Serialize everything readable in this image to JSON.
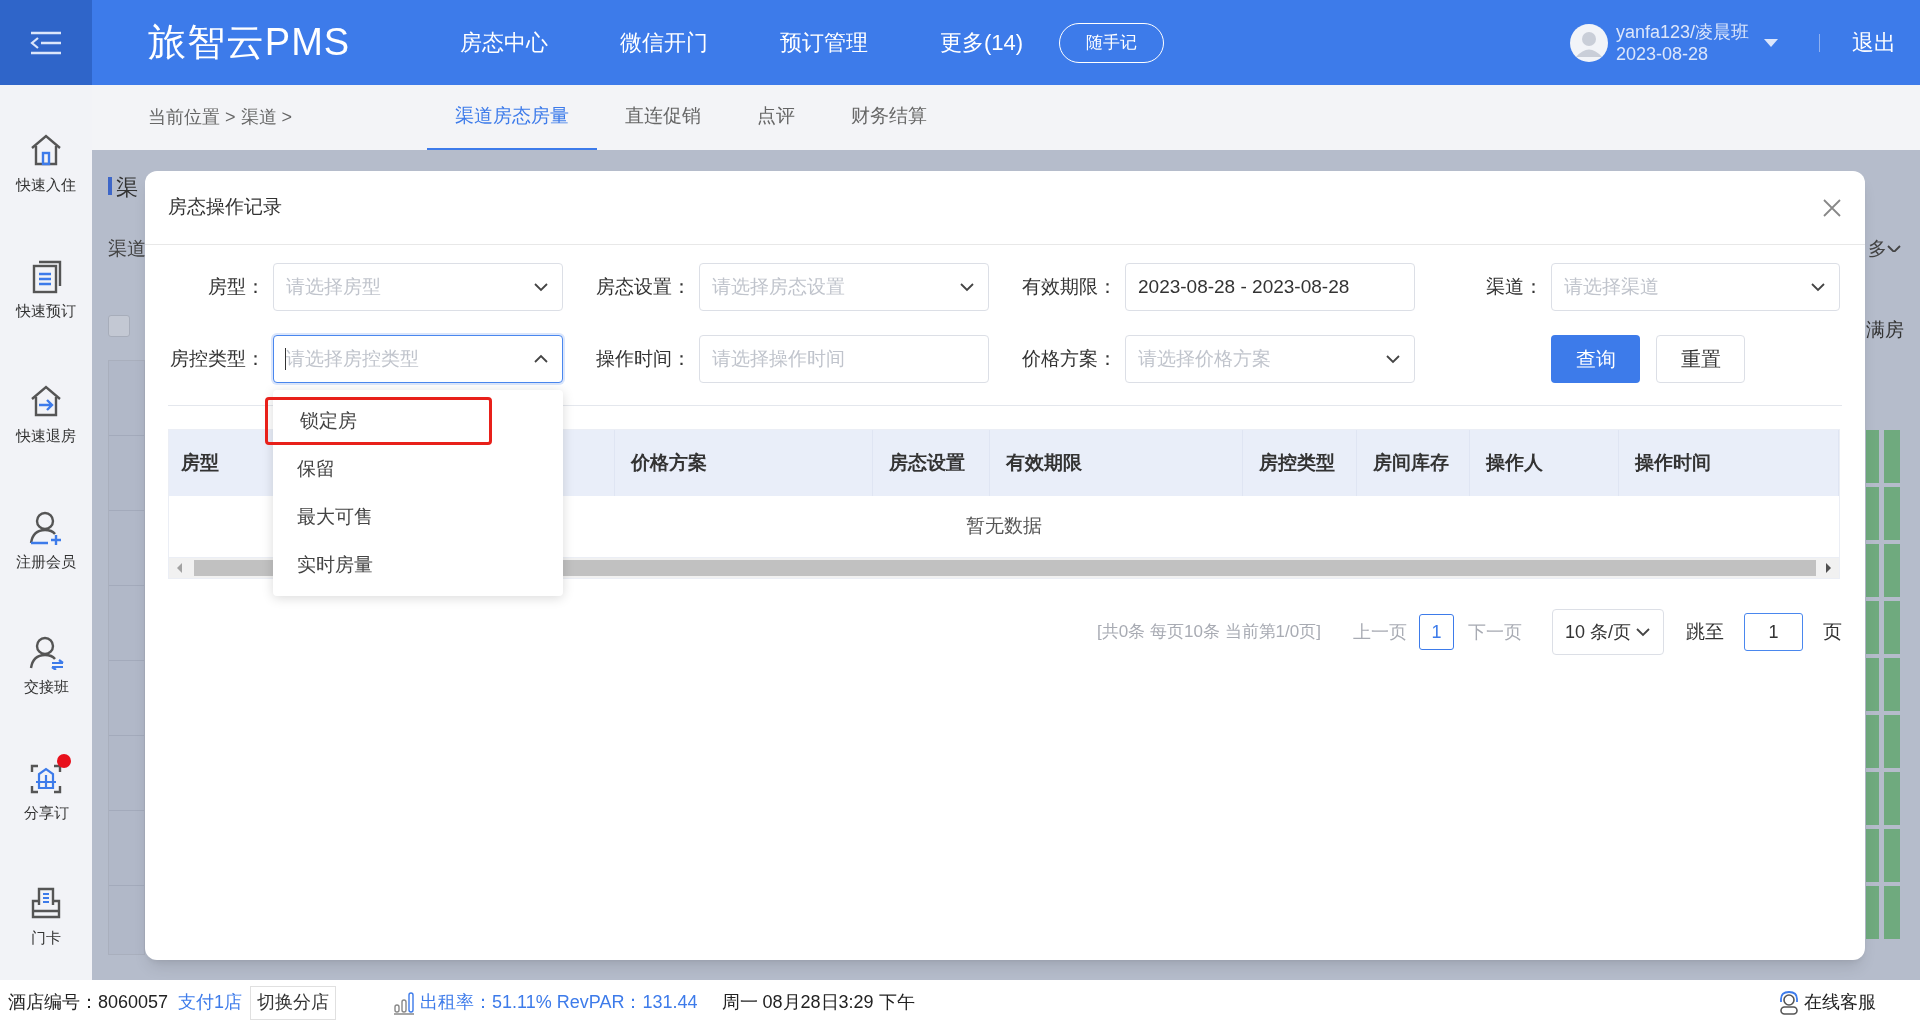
{
  "header": {
    "logo": "旅智云PMS",
    "nav": [
      "房态中心",
      "微信开门",
      "预订管理",
      "更多(14)"
    ],
    "note_button": "随手记",
    "user": {
      "name": "yanfa123/凌晨班",
      "date": "2023-08-28"
    },
    "logout": "退出"
  },
  "breadcrumb": "当前位置 > 渠道 >",
  "subtabs": [
    {
      "label": "渠道房态房量",
      "selected": true
    },
    {
      "label": "直连促销",
      "selected": false
    },
    {
      "label": "点评",
      "selected": false
    },
    {
      "label": "财务结算",
      "selected": false
    }
  ],
  "sidebar": [
    {
      "label": "快速入住",
      "notification": false
    },
    {
      "label": "快速预订",
      "notification": false
    },
    {
      "label": "快速退房",
      "notification": false
    },
    {
      "label": "注册会员",
      "notification": false
    },
    {
      "label": "交接班",
      "notification": false
    },
    {
      "label": "分享订",
      "notification": true
    },
    {
      "label": "门卡",
      "notification": false
    }
  ],
  "background": {
    "checked": false,
    "title": "渠",
    "label": "渠道",
    "more": "多",
    "full": "满房"
  },
  "dialog": {
    "title": "房态操作记录",
    "filters": [
      {
        "label": "房型：",
        "kind": "select",
        "placeholder": "请选择房型",
        "open": false
      },
      {
        "label": "房态设置：",
        "kind": "select",
        "placeholder": "请选择房态设置",
        "open": false
      },
      {
        "label": "有效期限：",
        "kind": "text",
        "value": "2023-08-28 - 2023-08-28"
      },
      {
        "label": "渠道：",
        "kind": "select",
        "placeholder": "请选择渠道",
        "open": false
      },
      {
        "label": "房控类型：",
        "kind": "select",
        "placeholder": "请选择房控类型",
        "open": true,
        "options": [
          {
            "label": "锁定房",
            "highlighted": true
          },
          {
            "label": "保留",
            "highlighted": false
          },
          {
            "label": "最大可售",
            "highlighted": false
          },
          {
            "label": "实时房量",
            "highlighted": false
          }
        ]
      },
      {
        "label": "操作时间：",
        "kind": "text",
        "placeholder": "请选择操作时间"
      },
      {
        "label": "价格方案：",
        "kind": "select",
        "placeholder": "请选择价格方案",
        "open": false
      }
    ],
    "buttons": [
      {
        "label": "查询",
        "primary": true
      },
      {
        "label": "重置",
        "primary": false
      }
    ],
    "table": {
      "columns": [
        "房型",
        "价格方案",
        "房态设置",
        "有效期限",
        "房控类型",
        "房间库存",
        "操作人",
        "操作时间"
      ],
      "empty": "暂无数据"
    },
    "pagination": {
      "summary": "[共0条 每页10条 当前第1/0页]",
      "prev": "上一页",
      "page": "1",
      "next": "下一页",
      "page_size": "10 条/页",
      "jump_label": "跳至",
      "jump_value": "1",
      "page_unit": "页"
    }
  },
  "status_bar": {
    "hotel_label": "酒店编号：8060057",
    "store": "支付1店",
    "switch": "切换分店",
    "stats": "出租率：51.11% RevPAR：131.44",
    "datetime": "周一 08月28日3:29 下午",
    "support": "在线客服"
  }
}
